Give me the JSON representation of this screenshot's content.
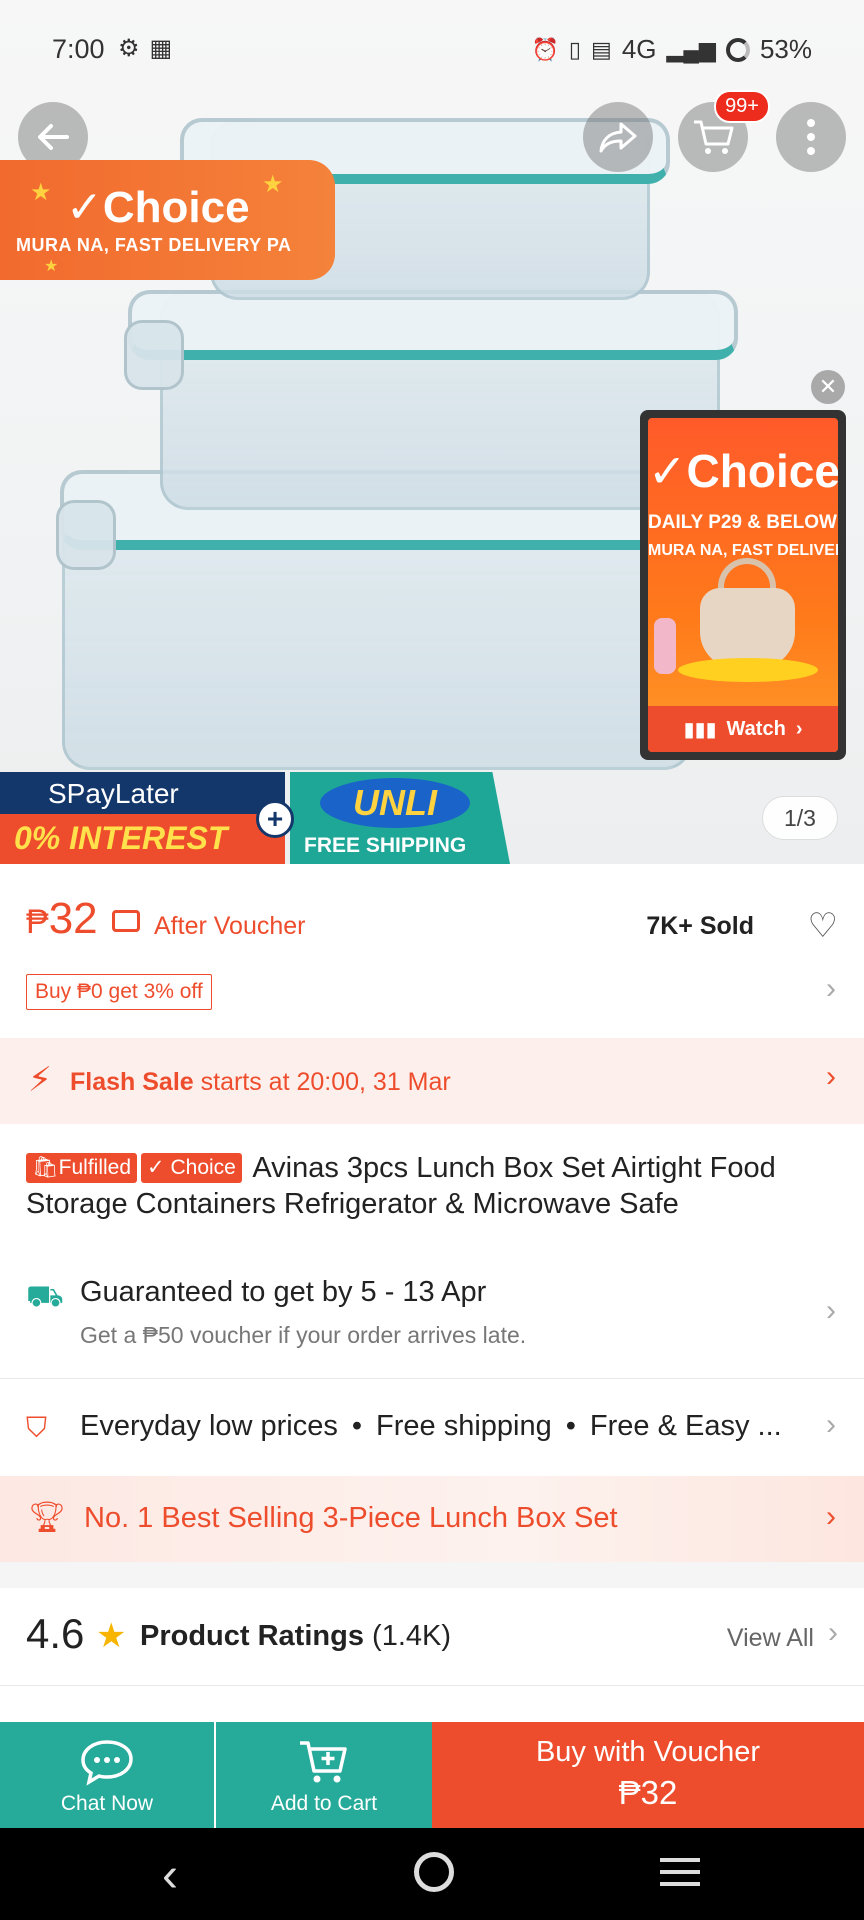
{
  "status_bar": {
    "time": "7:00",
    "network": "4G",
    "battery": "53%"
  },
  "header": {
    "cart_badge": "99+"
  },
  "hero": {
    "choice_banner_title": "✓Choice",
    "choice_banner_sub": "MURA NA, FAST DELIVERY PA",
    "video": {
      "title": "✓Choice",
      "line1": "DAILY P29 & BELOW",
      "line2": "MURA NA, FAST DELIVERY",
      "watch_label": "Watch"
    },
    "promo": {
      "spaylater": "SPayLater",
      "interest": "0% INTEREST",
      "unli": "UNLI",
      "free_shipping": "FREE SHIPPING"
    },
    "image_counter": "1/3"
  },
  "price": {
    "currency": "₱",
    "amount": "32",
    "after_voucher": "After Voucher",
    "sold": "7K+ Sold",
    "promo_tag": "Buy ₱0 get 3% off"
  },
  "flash_sale": {
    "label": "Flash Sale",
    "text": " starts at 20:00, 31 Mar"
  },
  "product": {
    "tag_fulfilled": "Fulfilled",
    "tag_choice": "✓ Choice",
    "title": "Avinas 3pcs Lunch Box Set Airtight Food Storage Containers Refrigerator & Microwave Safe"
  },
  "delivery": {
    "headline": "Guaranteed to get by 5 - 13 Apr",
    "subtext": "Get a ₱50 voucher if your order arrives late."
  },
  "features": {
    "items": [
      "Everyday low prices",
      "Free shipping",
      "Free & Easy ..."
    ]
  },
  "best_selling": {
    "text": "No. 1 Best Selling 3-Piece Lunch Box Set"
  },
  "ratings": {
    "score": "4.6",
    "title": "Product Ratings",
    "count": "(1.4K)",
    "view_all": "View All"
  },
  "action_bar": {
    "chat_label": "Chat Now",
    "cart_label": "Add to Cart",
    "buy_label": "Buy with Voucher",
    "buy_price": "₱32"
  },
  "colors": {
    "accent": "#ee4d2d",
    "teal": "#26aa99",
    "navy": "#14376b"
  }
}
